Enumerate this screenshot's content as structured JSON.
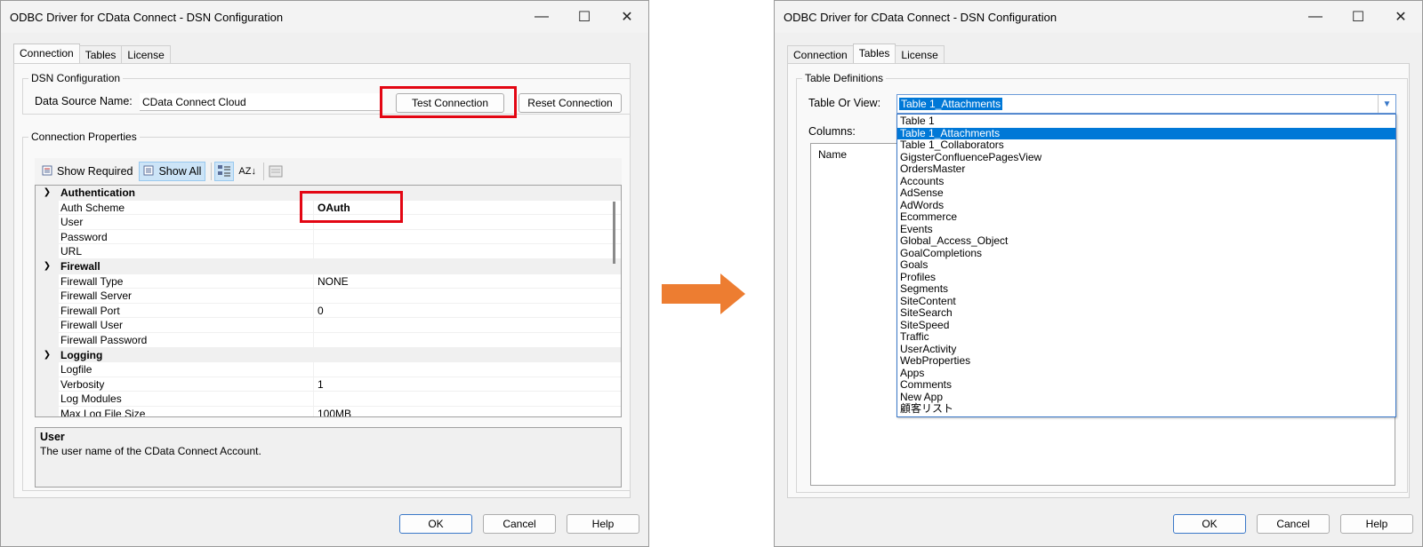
{
  "left_window": {
    "title": "ODBC Driver for CData Connect - DSN Configuration",
    "controls": [
      "—",
      "☐",
      "✕"
    ],
    "tabs": [
      "Connection",
      "Tables",
      "License"
    ],
    "active_tab": "Connection",
    "dsn_group_label": "DSN Configuration",
    "dsn_name_label": "Data Source Name:",
    "dsn_name_value": "CData Connect Cloud",
    "test_button": "Test Connection",
    "reset_button": "Reset Connection",
    "props_group_label": "Connection Properties",
    "toolbar": {
      "show_required": "Show Required",
      "show_all": "Show All",
      "sort_icon": "AZ↓"
    },
    "grid": [
      {
        "category": "Authentication",
        "rows": [
          [
            "Auth Scheme",
            "OAuth"
          ],
          [
            "User",
            ""
          ],
          [
            "Password",
            ""
          ],
          [
            "URL",
            ""
          ]
        ]
      },
      {
        "category": "Firewall",
        "rows": [
          [
            "Firewall Type",
            "NONE"
          ],
          [
            "Firewall Server",
            ""
          ],
          [
            "Firewall Port",
            "0"
          ],
          [
            "Firewall User",
            ""
          ],
          [
            "Firewall Password",
            ""
          ]
        ]
      },
      {
        "category": "Logging",
        "rows": [
          [
            "Logfile",
            ""
          ],
          [
            "Verbosity",
            "1"
          ],
          [
            "Log Modules",
            ""
          ],
          [
            "Max Log File Size",
            "100MB"
          ]
        ]
      }
    ],
    "description_title": "User",
    "description_text": "The user name of the CData Connect Account.",
    "ok": "OK",
    "cancel": "Cancel",
    "help": "Help"
  },
  "right_window": {
    "title": "ODBC Driver for CData Connect - DSN Configuration",
    "controls": [
      "—",
      "☐",
      "✕"
    ],
    "tabs": [
      "Connection",
      "Tables",
      "License"
    ],
    "active_tab": "Tables",
    "group_label": "Table Definitions",
    "table_label": "Table Or View:",
    "selected_table": "Table 1_Attachments",
    "columns_label": "Columns:",
    "list_header": "Name",
    "dropdown_items": [
      "Table 1",
      "Table 1_Attachments",
      "Table 1_Collaborators",
      "GigsterConfluencePagesView",
      "OrdersMaster",
      "Accounts",
      "AdSense",
      "AdWords",
      "Ecommerce",
      "Events",
      "Global_Access_Object",
      "GoalCompletions",
      "Goals",
      "Profiles",
      "Segments",
      "SiteContent",
      "SiteSearch",
      "SiteSpeed",
      "Traffic",
      "UserActivity",
      "WebProperties",
      "Apps",
      "Comments",
      "New App",
      "顧客リスト"
    ],
    "highlighted_index": 1,
    "ok": "OK",
    "cancel": "Cancel",
    "help": "Help"
  },
  "colors": {
    "highlight_box": "#e30613",
    "arrow": "#ed7d31",
    "selection": "#0078d7"
  }
}
